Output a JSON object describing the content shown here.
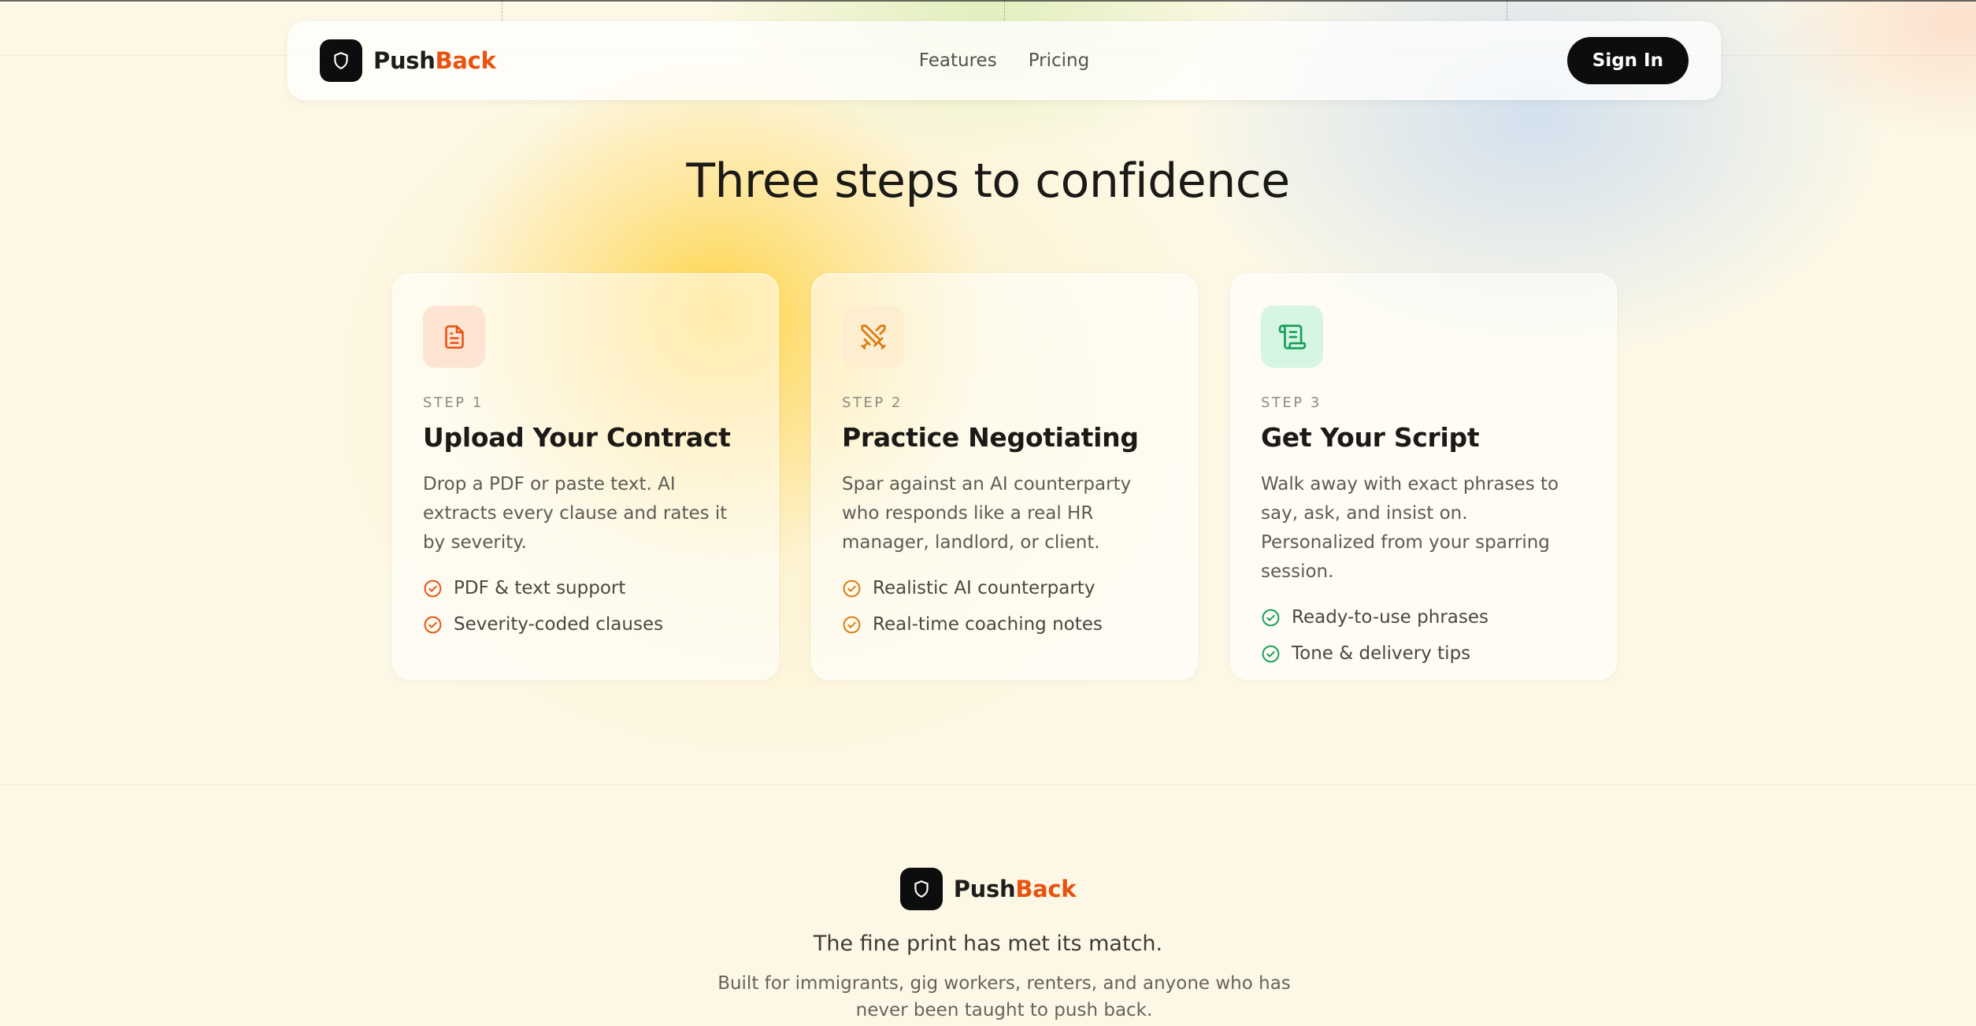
{
  "nav": {
    "brand": {
      "name_main": "Push",
      "name_accent": "Back",
      "logo_icon": "shield-icon"
    },
    "links": [
      {
        "label": "Features"
      },
      {
        "label": "Pricing"
      }
    ],
    "signin_label": "Sign In"
  },
  "main": {
    "heading": "Three steps to confidence",
    "cards": [
      {
        "icon": "document-icon",
        "icon_color": "#e8530f",
        "icon_bg": "#fde4d3",
        "step": "STEP 1",
        "title": "Upload Your Contract",
        "description": "Drop a PDF or paste text. AI extracts every clause and rates it by severity.",
        "check_color": "#e8530f",
        "features": [
          "PDF & text support",
          "Severity-coded clauses"
        ]
      },
      {
        "icon": "crossed-swords-icon",
        "icon_color": "#dc7b12",
        "icon_bg": "#fdeed0",
        "step": "STEP 2",
        "title": "Practice Negotiating",
        "description": "Spar against an AI counterparty who responds like a real HR manager, landlord, or client.",
        "check_color": "#dc7b12",
        "features": [
          "Realistic AI counterparty",
          "Real-time coaching notes"
        ]
      },
      {
        "icon": "scroll-icon",
        "icon_color": "#16a05a",
        "icon_bg": "#d6f5e2",
        "step": "STEP 3",
        "title": "Get Your Script",
        "description": "Walk away with exact phrases to say, ask, and insist on. Personalized from your sparring session.",
        "check_color": "#16a05a",
        "features": [
          "Ready-to-use phrases",
          "Tone & delivery tips"
        ]
      }
    ]
  },
  "footer": {
    "brand": {
      "name_main": "Push",
      "name_accent": "Back"
    },
    "tagline": "The fine print has met its match.",
    "subline": "Built for immigrants, gig workers, renters, and anyone who has never been taught to push back."
  },
  "colors": {
    "accent": "#e8530f",
    "background": "#fdf8e6",
    "primary_button": "#0d0d0d"
  }
}
